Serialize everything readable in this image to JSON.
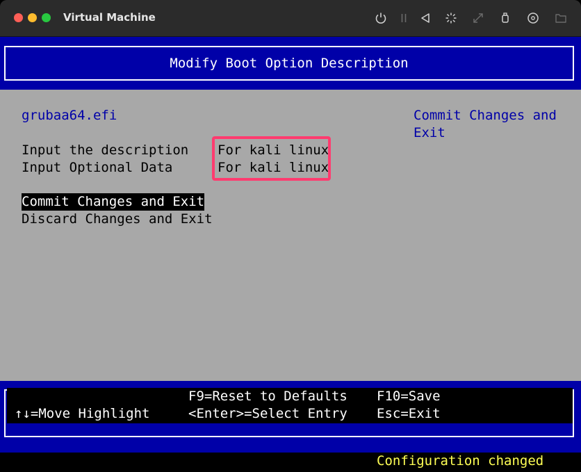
{
  "window": {
    "title": "Virtual Machine",
    "toolbar_icons": [
      "power-icon",
      "pause-icon",
      "back-icon",
      "sparkle-icon",
      "resize-icon",
      "usb-icon",
      "disc-icon",
      "folder-icon"
    ]
  },
  "bios": {
    "header_title": "Modify Boot Option Description",
    "file_name": "grubaa64.efi",
    "description_label": "Input the description",
    "description_value": "For kali linux",
    "optional_label": "Input Optional Data",
    "optional_value": "For kali linux",
    "commit_label": "Commit Changes and Exit",
    "discard_label": "Discard Changes and Exit",
    "help_text_line1": "Commit Changes and",
    "help_text_line2": "Exit"
  },
  "footer": {
    "move_highlight": "↑↓=Move Highlight",
    "reset_defaults": "F9=Reset to Defaults",
    "select_entry": "<Enter>=Select Entry",
    "save": "F10=Save",
    "exit": "Esc=Exit"
  },
  "status": {
    "message": "Configuration changed"
  },
  "colors": {
    "bios_blue": "#0000a8",
    "bios_gray": "#a8a8a8",
    "highlight_red": "#ff3b6f",
    "status_yellow": "#ffff55"
  }
}
